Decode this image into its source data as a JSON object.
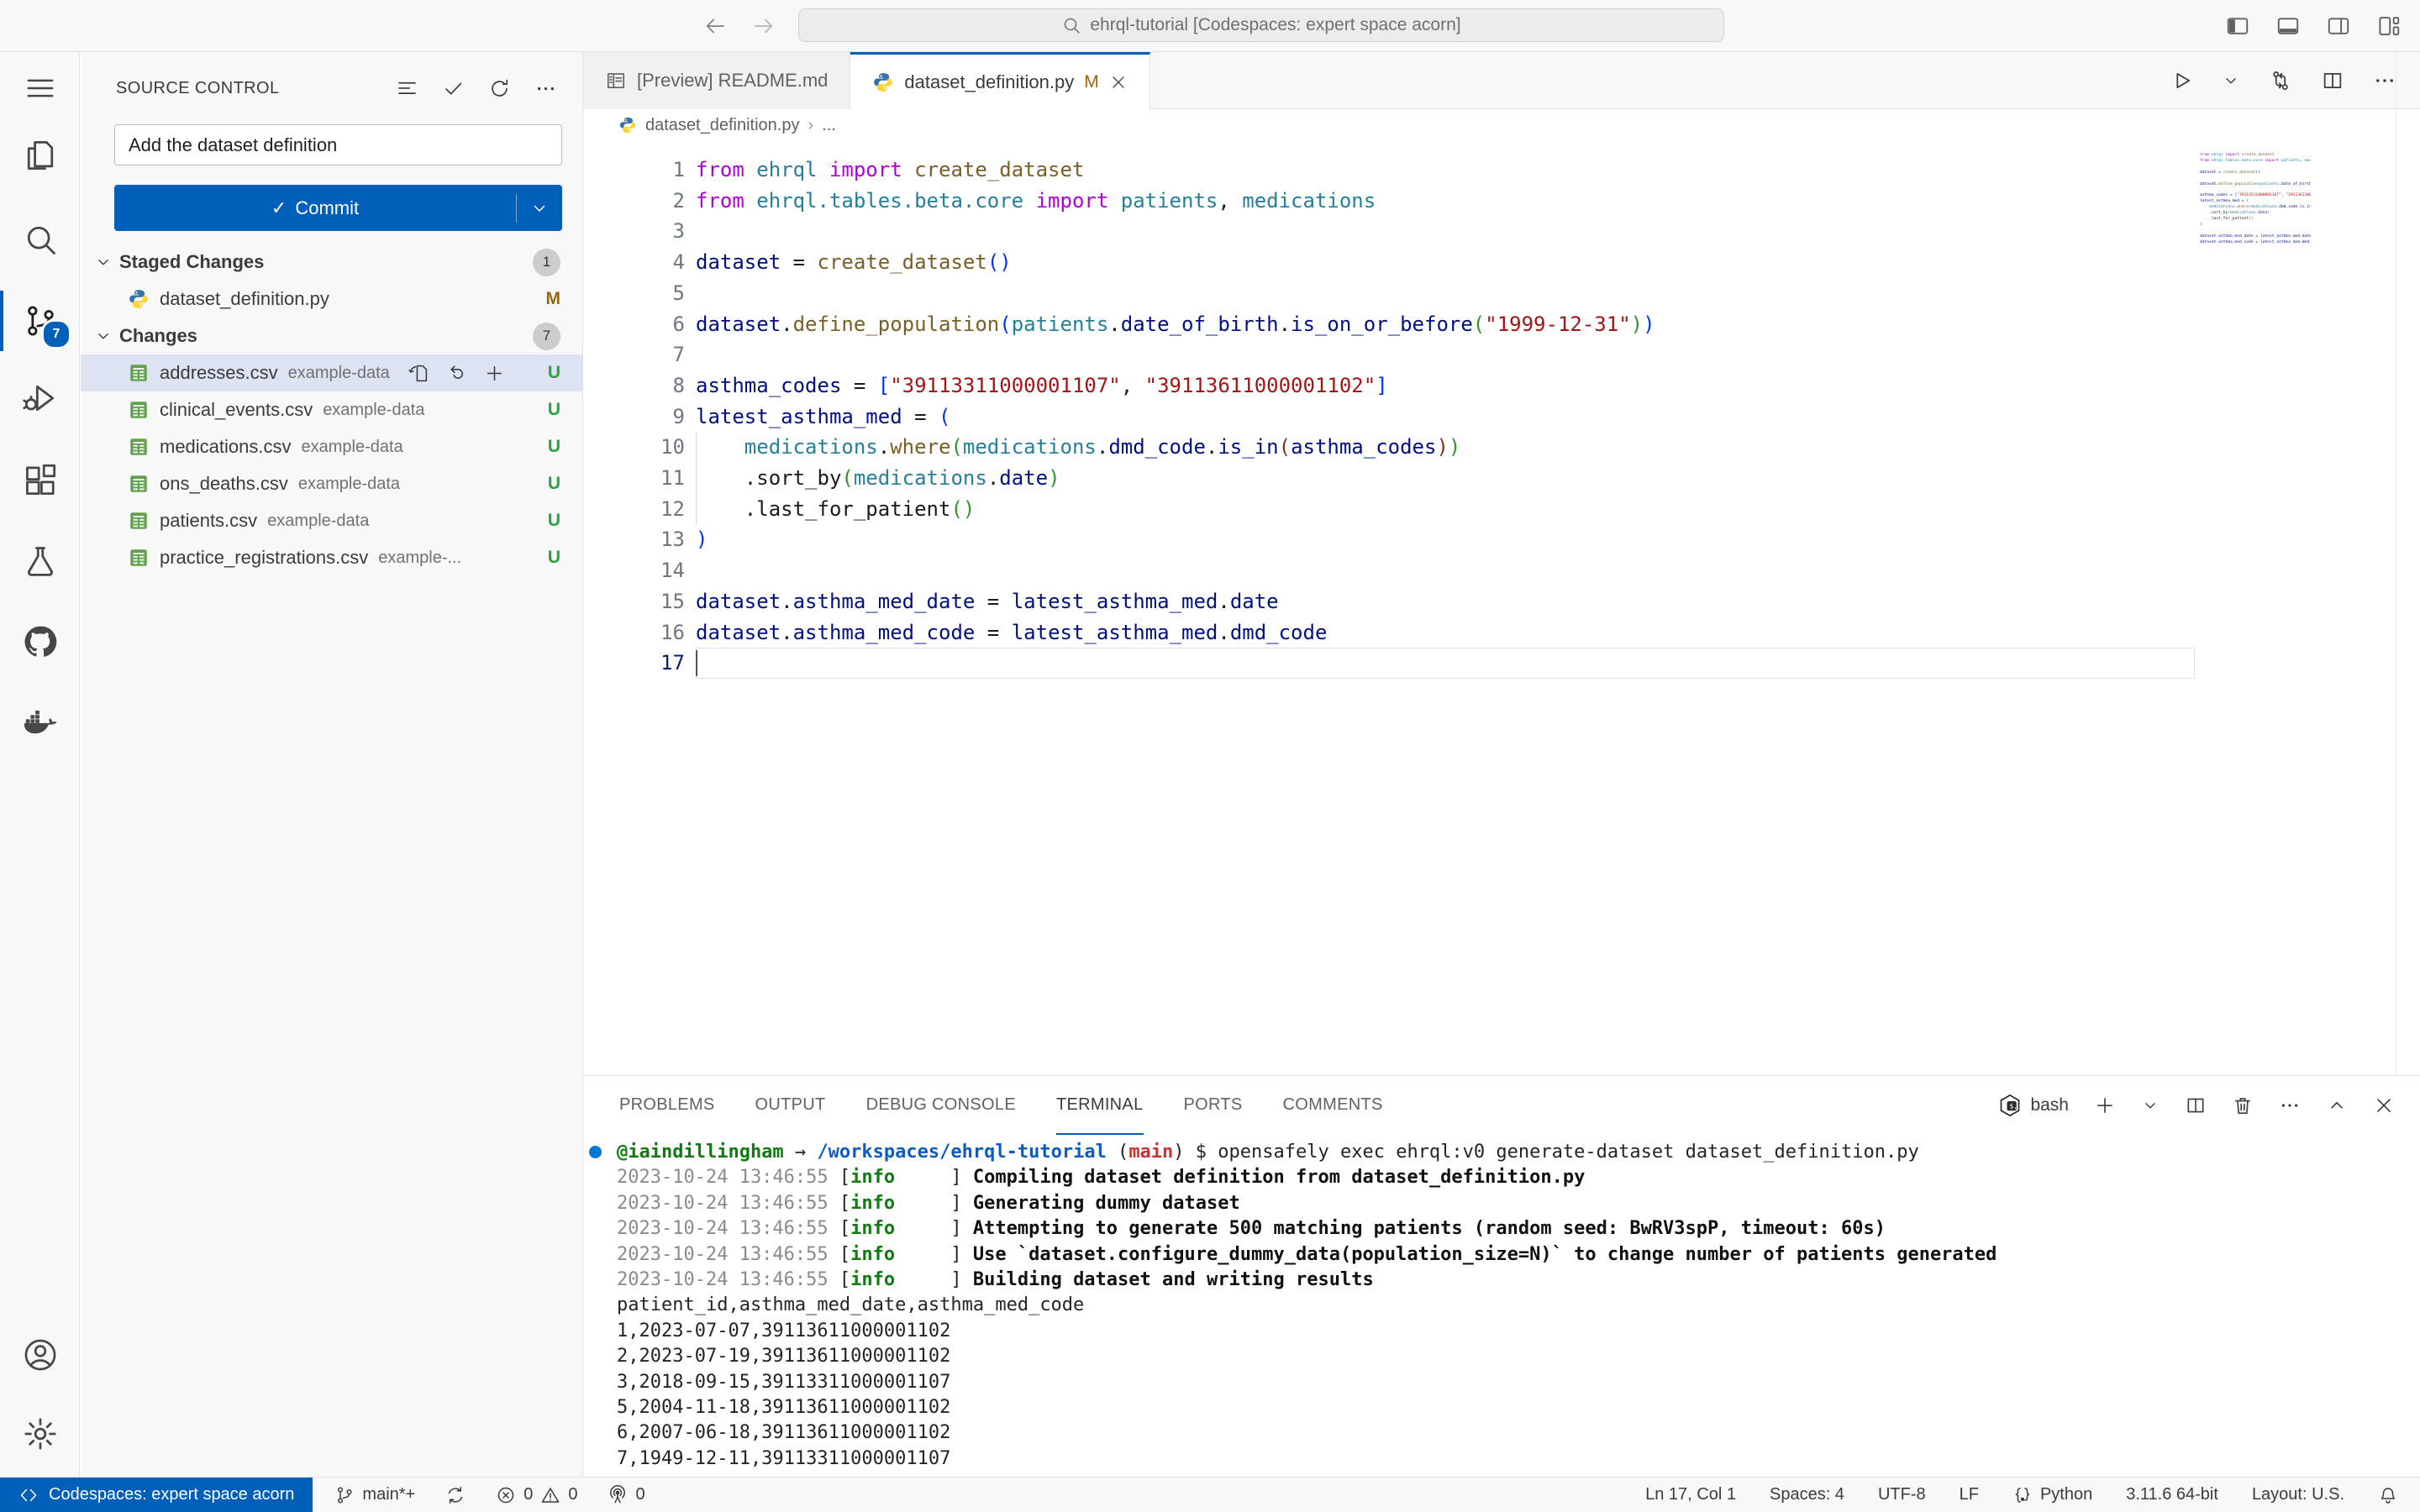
{
  "colors": {
    "accent": "#005FB8",
    "modified": "#9a6700",
    "untracked": "#2da042",
    "error_red": "#CD3131",
    "info_green": "#107C10",
    "path_blue": "#0f5bc5"
  },
  "window": {
    "search_text": "ehrql-tutorial [Codespaces: expert space acorn]"
  },
  "activity_bar": {
    "items": [
      {
        "icon": "menu",
        "name": "menu"
      },
      {
        "icon": "files",
        "name": "explorer"
      },
      {
        "icon": "search",
        "name": "search"
      },
      {
        "icon": "scm",
        "name": "source-control",
        "active": true,
        "badge": "7"
      },
      {
        "icon": "debug",
        "name": "run-and-debug"
      },
      {
        "icon": "extensions",
        "name": "extensions"
      },
      {
        "icon": "beaker",
        "name": "testing"
      },
      {
        "icon": "github",
        "name": "github"
      },
      {
        "icon": "docker",
        "name": "docker"
      }
    ],
    "bottom": [
      {
        "icon": "account",
        "name": "accounts"
      },
      {
        "icon": "gear",
        "name": "settings"
      }
    ]
  },
  "sidebar": {
    "title": "SOURCE CONTROL",
    "toolbar": [
      {
        "icon": "list",
        "name": "view-as-list"
      },
      {
        "icon": "check",
        "name": "commit"
      },
      {
        "icon": "refresh",
        "name": "refresh"
      },
      {
        "icon": "dots",
        "name": "more-actions"
      }
    ],
    "commit_input": "Add the dataset definition",
    "commit_label": "Commit",
    "sections": [
      {
        "label": "Staged Changes",
        "badge": "1",
        "rows": [
          {
            "icon": "python",
            "name": "dataset_definition.py",
            "desc": "",
            "status": "M"
          }
        ]
      },
      {
        "label": "Changes",
        "badge": "7",
        "rows": [
          {
            "icon": "csv",
            "name": "addresses.csv",
            "desc": "example-data",
            "status": "U",
            "selected": true,
            "actions": [
              "gotofile",
              "discard",
              "plus"
            ]
          },
          {
            "icon": "csv",
            "name": "clinical_events.csv",
            "desc": "example-data",
            "status": "U"
          },
          {
            "icon": "csv",
            "name": "medications.csv",
            "desc": "example-data",
            "status": "U"
          },
          {
            "icon": "csv",
            "name": "ons_deaths.csv",
            "desc": "example-data",
            "status": "U"
          },
          {
            "icon": "csv",
            "name": "patients.csv",
            "desc": "example-data",
            "status": "U"
          },
          {
            "icon": "csv",
            "name": "practice_registrations.csv",
            "desc": "example-...",
            "status": "U"
          }
        ]
      }
    ]
  },
  "editor": {
    "tabs": [
      {
        "icon": "mdpreview",
        "label": "[Preview] README.md",
        "active": false
      },
      {
        "icon": "python",
        "label": "dataset_definition.py",
        "active": true,
        "modified": "M",
        "closable": true
      }
    ],
    "actions": [
      {
        "icon": "run",
        "name": "run-python-file"
      },
      {
        "icon": "chevdown",
        "name": "run-dropdown"
      },
      {
        "icon": "openchanges",
        "name": "open-changes"
      },
      {
        "icon": "spliteditor",
        "name": "split-editor"
      },
      {
        "icon": "dots",
        "name": "more-actions"
      }
    ],
    "breadcrumb": {
      "file": "dataset_definition.py",
      "separator": "›",
      "rest": "..."
    },
    "cursor_line": 17,
    "code": [
      [
        [
          "c-k",
          "from"
        ],
        [
          "c-p",
          " "
        ],
        [
          "c-m",
          "ehrql"
        ],
        [
          "c-p",
          " "
        ],
        [
          "c-k",
          "import"
        ],
        [
          "c-p",
          " "
        ],
        [
          "c-f",
          "create_dataset"
        ]
      ],
      [
        [
          "c-k",
          "from"
        ],
        [
          "c-p",
          " "
        ],
        [
          "c-m",
          "ehrql.tables.beta.core"
        ],
        [
          "c-p",
          " "
        ],
        [
          "c-k",
          "import"
        ],
        [
          "c-p",
          " "
        ],
        [
          "c-m",
          "patients"
        ],
        [
          "c-p",
          ", "
        ],
        [
          "c-m",
          "medications"
        ]
      ],
      [],
      [
        [
          "c-v",
          "dataset"
        ],
        [
          "c-p",
          " = "
        ],
        [
          "c-f",
          "create_dataset"
        ],
        [
          "c-b1",
          "()"
        ]
      ],
      [],
      [
        [
          "c-v",
          "dataset"
        ],
        [
          "c-p",
          "."
        ],
        [
          "c-f",
          "define_population"
        ],
        [
          "c-b1",
          "("
        ],
        [
          "c-m",
          "patients"
        ],
        [
          "c-p",
          "."
        ],
        [
          "c-v",
          "date_of_birth"
        ],
        [
          "c-p",
          "."
        ],
        [
          "c-v",
          "is_on_or_before"
        ],
        [
          "c-b2",
          "("
        ],
        [
          "c-s",
          "\"1999-12-31\""
        ],
        [
          "c-b2",
          ")"
        ],
        [
          "c-b1",
          ")"
        ]
      ],
      [],
      [
        [
          "c-v",
          "asthma_codes"
        ],
        [
          "c-p",
          " = "
        ],
        [
          "c-b1",
          "["
        ],
        [
          "c-s",
          "\"39113311000001107\""
        ],
        [
          "c-p",
          ", "
        ],
        [
          "c-s",
          "\"39113611000001102\""
        ],
        [
          "c-b1",
          "]"
        ]
      ],
      [
        [
          "c-v",
          "latest_asthma_med"
        ],
        [
          "c-p",
          " = "
        ],
        [
          "c-b1",
          "("
        ]
      ],
      [
        [
          "c-p",
          "    "
        ],
        [
          "c-m",
          "medications"
        ],
        [
          "c-p",
          "."
        ],
        [
          "c-f",
          "where"
        ],
        [
          "c-b2",
          "("
        ],
        [
          "c-m",
          "medications"
        ],
        [
          "c-p",
          "."
        ],
        [
          "c-v",
          "dmd_code"
        ],
        [
          "c-p",
          "."
        ],
        [
          "c-v",
          "is_in"
        ],
        [
          "c-b3",
          "("
        ],
        [
          "c-v",
          "asthma_codes"
        ],
        [
          "c-b3",
          ")"
        ],
        [
          "c-b2",
          ")"
        ]
      ],
      [
        [
          "c-p",
          "    ."
        ],
        [
          "c-p",
          "sort_by"
        ],
        [
          "c-b2",
          "("
        ],
        [
          "c-m",
          "medications"
        ],
        [
          "c-p",
          "."
        ],
        [
          "c-v",
          "date"
        ],
        [
          "c-b2",
          ")"
        ]
      ],
      [
        [
          "c-p",
          "    .last_for_patient"
        ],
        [
          "c-b2",
          "()"
        ]
      ],
      [
        [
          "c-b1",
          ")"
        ]
      ],
      [],
      [
        [
          "c-v",
          "dataset"
        ],
        [
          "c-p",
          "."
        ],
        [
          "c-v",
          "asthma_med_date"
        ],
        [
          "c-p",
          " = "
        ],
        [
          "c-v",
          "latest_asthma_med"
        ],
        [
          "c-p",
          "."
        ],
        [
          "c-v",
          "date"
        ]
      ],
      [
        [
          "c-v",
          "dataset"
        ],
        [
          "c-p",
          "."
        ],
        [
          "c-v",
          "asthma_med_code"
        ],
        [
          "c-p",
          " = "
        ],
        [
          "c-v",
          "latest_asthma_med"
        ],
        [
          "c-p",
          "."
        ],
        [
          "c-v",
          "dmd_code"
        ]
      ],
      []
    ]
  },
  "panel": {
    "tabs": [
      "PROBLEMS",
      "OUTPUT",
      "DEBUG CONSOLE",
      "TERMINAL",
      "PORTS",
      "COMMENTS"
    ],
    "active_tab": "TERMINAL",
    "shell_label": "bash",
    "actions": [
      {
        "icon": "plus",
        "name": "new-terminal"
      },
      {
        "icon": "chevdown",
        "name": "launch-profile-dropdown"
      },
      {
        "icon": "spliteditor",
        "name": "split-terminal"
      },
      {
        "icon": "trash",
        "name": "kill-terminal"
      },
      {
        "icon": "dots",
        "name": "more-actions"
      },
      {
        "icon": "chevup",
        "name": "maximize-panel"
      },
      {
        "icon": "close",
        "name": "close-panel"
      }
    ],
    "terminal": [
      {
        "decorated": true,
        "t": [
          [
            "t-g",
            "@iaindillingham"
          ],
          [
            "t-p",
            " → "
          ],
          [
            "t-b",
            "/workspaces/ehrql-tutorial"
          ],
          [
            "t-p",
            " ("
          ],
          [
            "t-r",
            "main"
          ],
          [
            "t-p",
            ") $ opensafely exec ehrql:v0 generate-dataset dataset_definition.py"
          ]
        ]
      },
      {
        "t": [
          [
            "t-dim",
            "2023-10-24 13:46:55 "
          ],
          [
            "t-p",
            "["
          ],
          [
            "t-g",
            "info"
          ],
          [
            "t-p",
            "     ] "
          ],
          [
            "t-bold",
            "Compiling dataset definition from dataset_definition.py"
          ]
        ]
      },
      {
        "t": [
          [
            "t-dim",
            "2023-10-24 13:46:55 "
          ],
          [
            "t-p",
            "["
          ],
          [
            "t-g",
            "info"
          ],
          [
            "t-p",
            "     ] "
          ],
          [
            "t-bold",
            "Generating dummy dataset"
          ]
        ]
      },
      {
        "t": [
          [
            "t-dim",
            "2023-10-24 13:46:55 "
          ],
          [
            "t-p",
            "["
          ],
          [
            "t-g",
            "info"
          ],
          [
            "t-p",
            "     ] "
          ],
          [
            "t-bold",
            "Attempting to generate 500 matching patients (random seed: BwRV3spP, timeout: 60s)"
          ]
        ]
      },
      {
        "t": [
          [
            "t-dim",
            "2023-10-24 13:46:55 "
          ],
          [
            "t-p",
            "["
          ],
          [
            "t-g",
            "info"
          ],
          [
            "t-p",
            "     ] "
          ],
          [
            "t-bold",
            "Use `dataset.configure_dummy_data(population_size=N)` to change number of patients generated"
          ]
        ]
      },
      {
        "t": [
          [
            "t-dim",
            "2023-10-24 13:46:55 "
          ],
          [
            "t-p",
            "["
          ],
          [
            "t-g",
            "info"
          ],
          [
            "t-p",
            "     ] "
          ],
          [
            "t-bold",
            "Building dataset and writing results"
          ]
        ]
      },
      {
        "t": [
          [
            "t-p",
            "patient_id,asthma_med_date,asthma_med_code"
          ]
        ]
      },
      {
        "t": [
          [
            "t-p",
            "1,2023-07-07,39113611000001102"
          ]
        ]
      },
      {
        "t": [
          [
            "t-p",
            "2,2023-07-19,39113611000001102"
          ]
        ]
      },
      {
        "t": [
          [
            "t-p",
            "3,2018-09-15,39113311000001107"
          ]
        ]
      },
      {
        "t": [
          [
            "t-p",
            "5,2004-11-18,39113611000001102"
          ]
        ]
      },
      {
        "t": [
          [
            "t-p",
            "6,2007-06-18,39113611000001102"
          ]
        ]
      },
      {
        "t": [
          [
            "t-p",
            "7,1949-12-11,39113311000001107"
          ]
        ]
      }
    ]
  },
  "status_bar": {
    "remote_label": "Codespaces: expert space acorn",
    "branch": "main*+",
    "errors": "0",
    "warnings": "0",
    "broadcast": "0",
    "right": [
      {
        "label": "Ln 17, Col 1",
        "name": "cursor-position"
      },
      {
        "label": "Spaces: 4",
        "name": "indentation"
      },
      {
        "label": "UTF-8",
        "name": "encoding"
      },
      {
        "label": "LF",
        "name": "end-of-line"
      },
      {
        "label": "Python",
        "name": "language-mode",
        "icon": "braces"
      },
      {
        "label": "3.11.6 64-bit",
        "name": "python-interpreter"
      },
      {
        "label": "Layout: U.S.",
        "name": "keyboard-layout"
      },
      {
        "label": "",
        "name": "notifications",
        "icon": "bell"
      }
    ]
  }
}
